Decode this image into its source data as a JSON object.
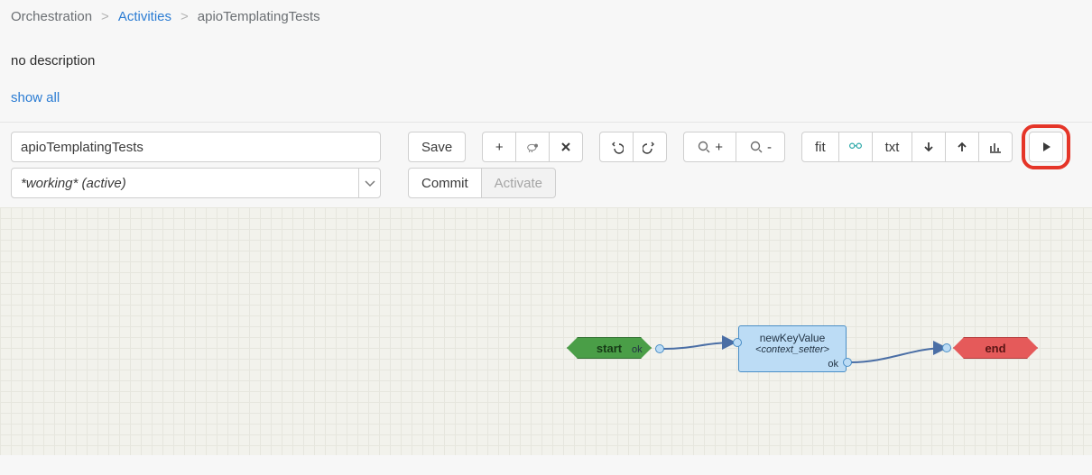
{
  "breadcrumbs": {
    "root": "Orchestration",
    "link": "Activities",
    "current": "apioTemplatingTests"
  },
  "description": "no description",
  "show_all": "show all",
  "inputs": {
    "activity_name": "apioTemplatingTests",
    "version_selected": "*working* (active)"
  },
  "buttons": {
    "save": "Save",
    "commit": "Commit",
    "activate": "Activate",
    "fit": "fit",
    "txt": "txt",
    "plus": "+",
    "zoom_in_suffix": "+",
    "zoom_out_suffix": "-"
  },
  "nodes": {
    "start": {
      "label": "start",
      "port": "ok"
    },
    "mid": {
      "title": "newKeyValue",
      "subtitle": "<context_setter>",
      "port": "ok"
    },
    "end": {
      "label": "end"
    }
  },
  "icons": {
    "sheep": "sheep-icon",
    "delete": "x-icon",
    "undo": "undo-icon",
    "redo": "redo-icon",
    "zoom": "magnifier-icon",
    "glasses": "glasses-icon",
    "down": "arrow-down-icon",
    "up": "arrow-up-icon",
    "chart": "bar-chart-icon",
    "play": "play-icon",
    "chevron": "chevron-down-icon"
  }
}
